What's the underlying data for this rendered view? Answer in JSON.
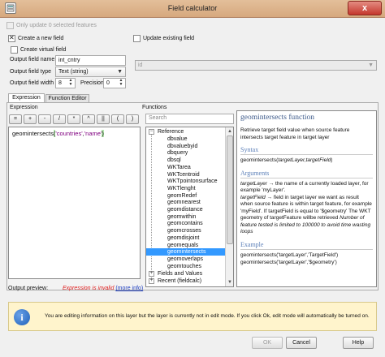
{
  "window": {
    "title": "Field calculator",
    "close_label": "x"
  },
  "options": {
    "only_update_selected": "Only update 0 selected features",
    "create_new_field": "Create a new field",
    "update_existing_field": "Update existing field",
    "create_virtual_field": "Create virtual field"
  },
  "fields": {
    "output_field_name_label": "Output field name",
    "output_field_name_value": "int_cntry",
    "output_field_type_label": "Output field type",
    "output_field_type_value": "Text (string)",
    "output_field_width_label": "Output field width",
    "output_field_width_value": "8",
    "precision_label": "Precision",
    "precision_value": "0",
    "existing_field_value": "id"
  },
  "tabs": [
    {
      "label": "Expression"
    },
    {
      "label": "Function Editor"
    }
  ],
  "expression": {
    "section_label": "Expression",
    "operators": [
      "=",
      "+",
      "-",
      "/",
      "*",
      "^",
      "||",
      "(",
      ")"
    ],
    "code_func": "geomintersects",
    "code_open": "(",
    "code_arg1": "'countries'",
    "code_comma": ",",
    "code_arg2": "'name'",
    "code_close": ")"
  },
  "functions": {
    "section_label": "Functions",
    "search_placeholder": "Search",
    "group_reference": "Reference",
    "items": [
      "dbvalue",
      "dbvaluebyid",
      "dbquery",
      "dbsql",
      "WKTarea",
      "WKTcentroid",
      "WKTpointonsurface",
      "WKTlenght",
      "geomRedef",
      "geomnearest",
      "geomdistance",
      "geomwithin",
      "geomcontains",
      "geomcrosses",
      "geomdisjoint",
      "geomequals",
      "geomintersects",
      "geomoverlaps",
      "geomtouches"
    ],
    "selected": "geomintersects",
    "group_fields": "Fields and Values",
    "group_recent": "Recent (fieldcalc)"
  },
  "help": {
    "title": "geomintersects function",
    "description": "Retrieve target field value when source feature intersects target feature in target layer",
    "syntax_heading": "Syntax",
    "syntax_prefix": "geomintersects(",
    "syntax_args": "targetLayer,targetField",
    "syntax_suffix": ")",
    "arguments_heading": "Arguments",
    "arg1_name": "targetLayer",
    "arg1_desc": " → the name of a currently loaded layer, for example 'myLayer'.",
    "arg2_name": "targetField",
    "arg2_desc": " → field in target layer we want as result when source feature is within target feature, for example 'myField'. If targetField is equal to '$geometry' The WKT geometry of targetFeature willbe retrieved ",
    "limit_note": "Number of feature tested is limited to 100000 to avoid time wasting loops",
    "example_heading": "Example",
    "example1": "geomintersects('targetLayer','TargetField')",
    "example2": "geomintersects('targetLayer','$geometry')"
  },
  "preview": {
    "label": "Output preview:",
    "invalid_text": "Expression is invalid",
    "more_info": "(more info)"
  },
  "info_bar": {
    "message": "You are editing information on this layer but the layer is currently not in edit mode. If you click Ok, edit mode will automatically be turned on."
  },
  "buttons": {
    "ok": "OK",
    "cancel": "Cancel",
    "help": "Help"
  },
  "colors": {
    "title_bar": "#d9ae86",
    "close_button": "#c4372d",
    "selection": "#3399ff",
    "invalid_text": "#e02020",
    "link": "#2040c0",
    "info_bar": "#fff4cc"
  }
}
